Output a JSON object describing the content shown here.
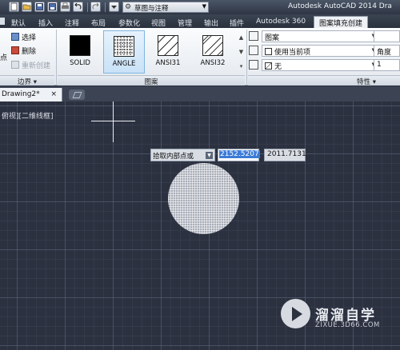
{
  "app": {
    "title": "Autodesk AutoCAD 2014   Dra",
    "workspace": "草图与注释"
  },
  "ribbon_tabs": [
    "默认",
    "插入",
    "注释",
    "布局",
    "参数化",
    "视图",
    "管理",
    "输出",
    "插件",
    "Autodesk 360",
    "图案填充创建"
  ],
  "active_tab": "图案填充创建",
  "boundary_panel": {
    "commands": [
      {
        "label": "选择",
        "icon": "select-icon"
      },
      {
        "label": "删除",
        "icon": "delete-icon"
      },
      {
        "label": "重新创建",
        "icon": "recreate-icon",
        "disabled": true
      }
    ],
    "left_partial_label": "点",
    "title": "边界 ▾"
  },
  "pattern_panel": {
    "patterns": [
      "SOLID",
      "ANGLE",
      "ANSI31",
      "ANSI32"
    ],
    "selected": "ANGLE",
    "title": "图案"
  },
  "properties_panel": {
    "hatch_type": "图案",
    "hatch_color": "使用当前项",
    "background_color": "无",
    "transparency": "",
    "angle": "角度",
    "scale": "1",
    "title": "特性 ▾"
  },
  "file_tab": {
    "label": "Drawing2*",
    "close": "×"
  },
  "viewport_label": "俯视][二维线框]",
  "dynamic_input": {
    "prompt": "拾取内部点或",
    "down_arrow": "▼",
    "x_value": "2152.5207",
    "y_value": "2011.7131"
  },
  "watermark": {
    "name": "溜溜自学",
    "url": "ZIXUE.3D66.COM"
  },
  "colors": {
    "canvas_bg": "#2c3140",
    "selection_blue": "#3b7bd6",
    "ribbon_bg": "#eef1f5"
  }
}
